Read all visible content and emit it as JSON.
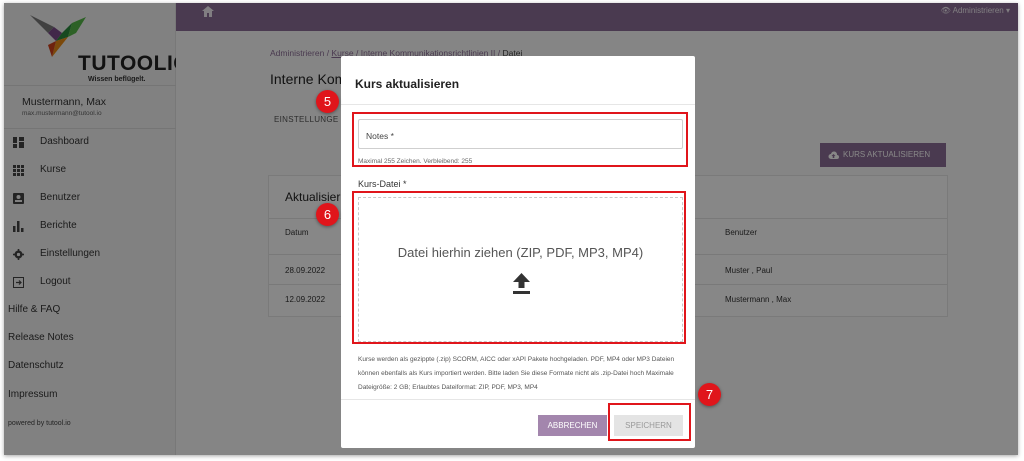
{
  "sidebar": {
    "logo_name": "TUTOOLIO",
    "logo_tagline": "Wissen beflügelt.",
    "user_name": "Mustermann, Max",
    "user_email": "max.mustermann@tutool.io",
    "nav": [
      {
        "label": "Dashboard",
        "icon": "dashboard-icon"
      },
      {
        "label": "Kurse",
        "icon": "grid-icon"
      },
      {
        "label": "Benutzer",
        "icon": "user-card-icon"
      },
      {
        "label": "Berichte",
        "icon": "bar-chart-icon"
      },
      {
        "label": "Einstellungen",
        "icon": "gear-icon"
      },
      {
        "label": "Logout",
        "icon": "logout-icon"
      }
    ],
    "links": [
      "Hilfe & FAQ",
      "Release Notes",
      "Datenschutz",
      "Impressum"
    ],
    "powered": "powered by tutool.io"
  },
  "topbar": {
    "admin_label": "Administrieren",
    "accent": "#8d6f97"
  },
  "page": {
    "breadcrumb": [
      "Administrieren",
      "Kurse",
      "Interne Kommunikationsrichtlinien II",
      "Datei"
    ],
    "title": "Interne Kom",
    "tab": "EINSTELLUNGE",
    "update_button": "KURS AKTUALISIEREN",
    "card_title": "Aktualisieru",
    "columns": {
      "date": "Datum",
      "user": "Benutzer"
    },
    "rows": [
      {
        "date": "28.09.2022",
        "user": "Muster , Paul"
      },
      {
        "date": "12.09.2022",
        "user": "Mustermann , Max"
      }
    ]
  },
  "modal": {
    "title": "Kurs aktualisieren",
    "notes_placeholder": "Notes *",
    "notes_hint": "Maximal 255 Zeichen. Verbleibend: 255",
    "file_label": "Kurs-Datei *",
    "dropzone_text": "Datei hierhin ziehen (ZIP, PDF, MP3, MP4)",
    "info_text": "Kurse werden als gezippte (.zip) SCORM, AICC oder xAPI Pakete hochgeladen. PDF, MP4 oder MP3 Dateien können ebenfalls als Kurs importiert werden. Bitte laden Sie diese Formate nicht als .zip-Datei hoch Maximale Dateigröße: 2 GB; Erlaubtes Dateiformat: ZIP, PDF, MP3, MP4",
    "cancel": "ABBRECHEN",
    "save": "SPEICHERN"
  },
  "annotations": {
    "markers": [
      "5",
      "6",
      "7"
    ],
    "color": "#e0151b"
  }
}
